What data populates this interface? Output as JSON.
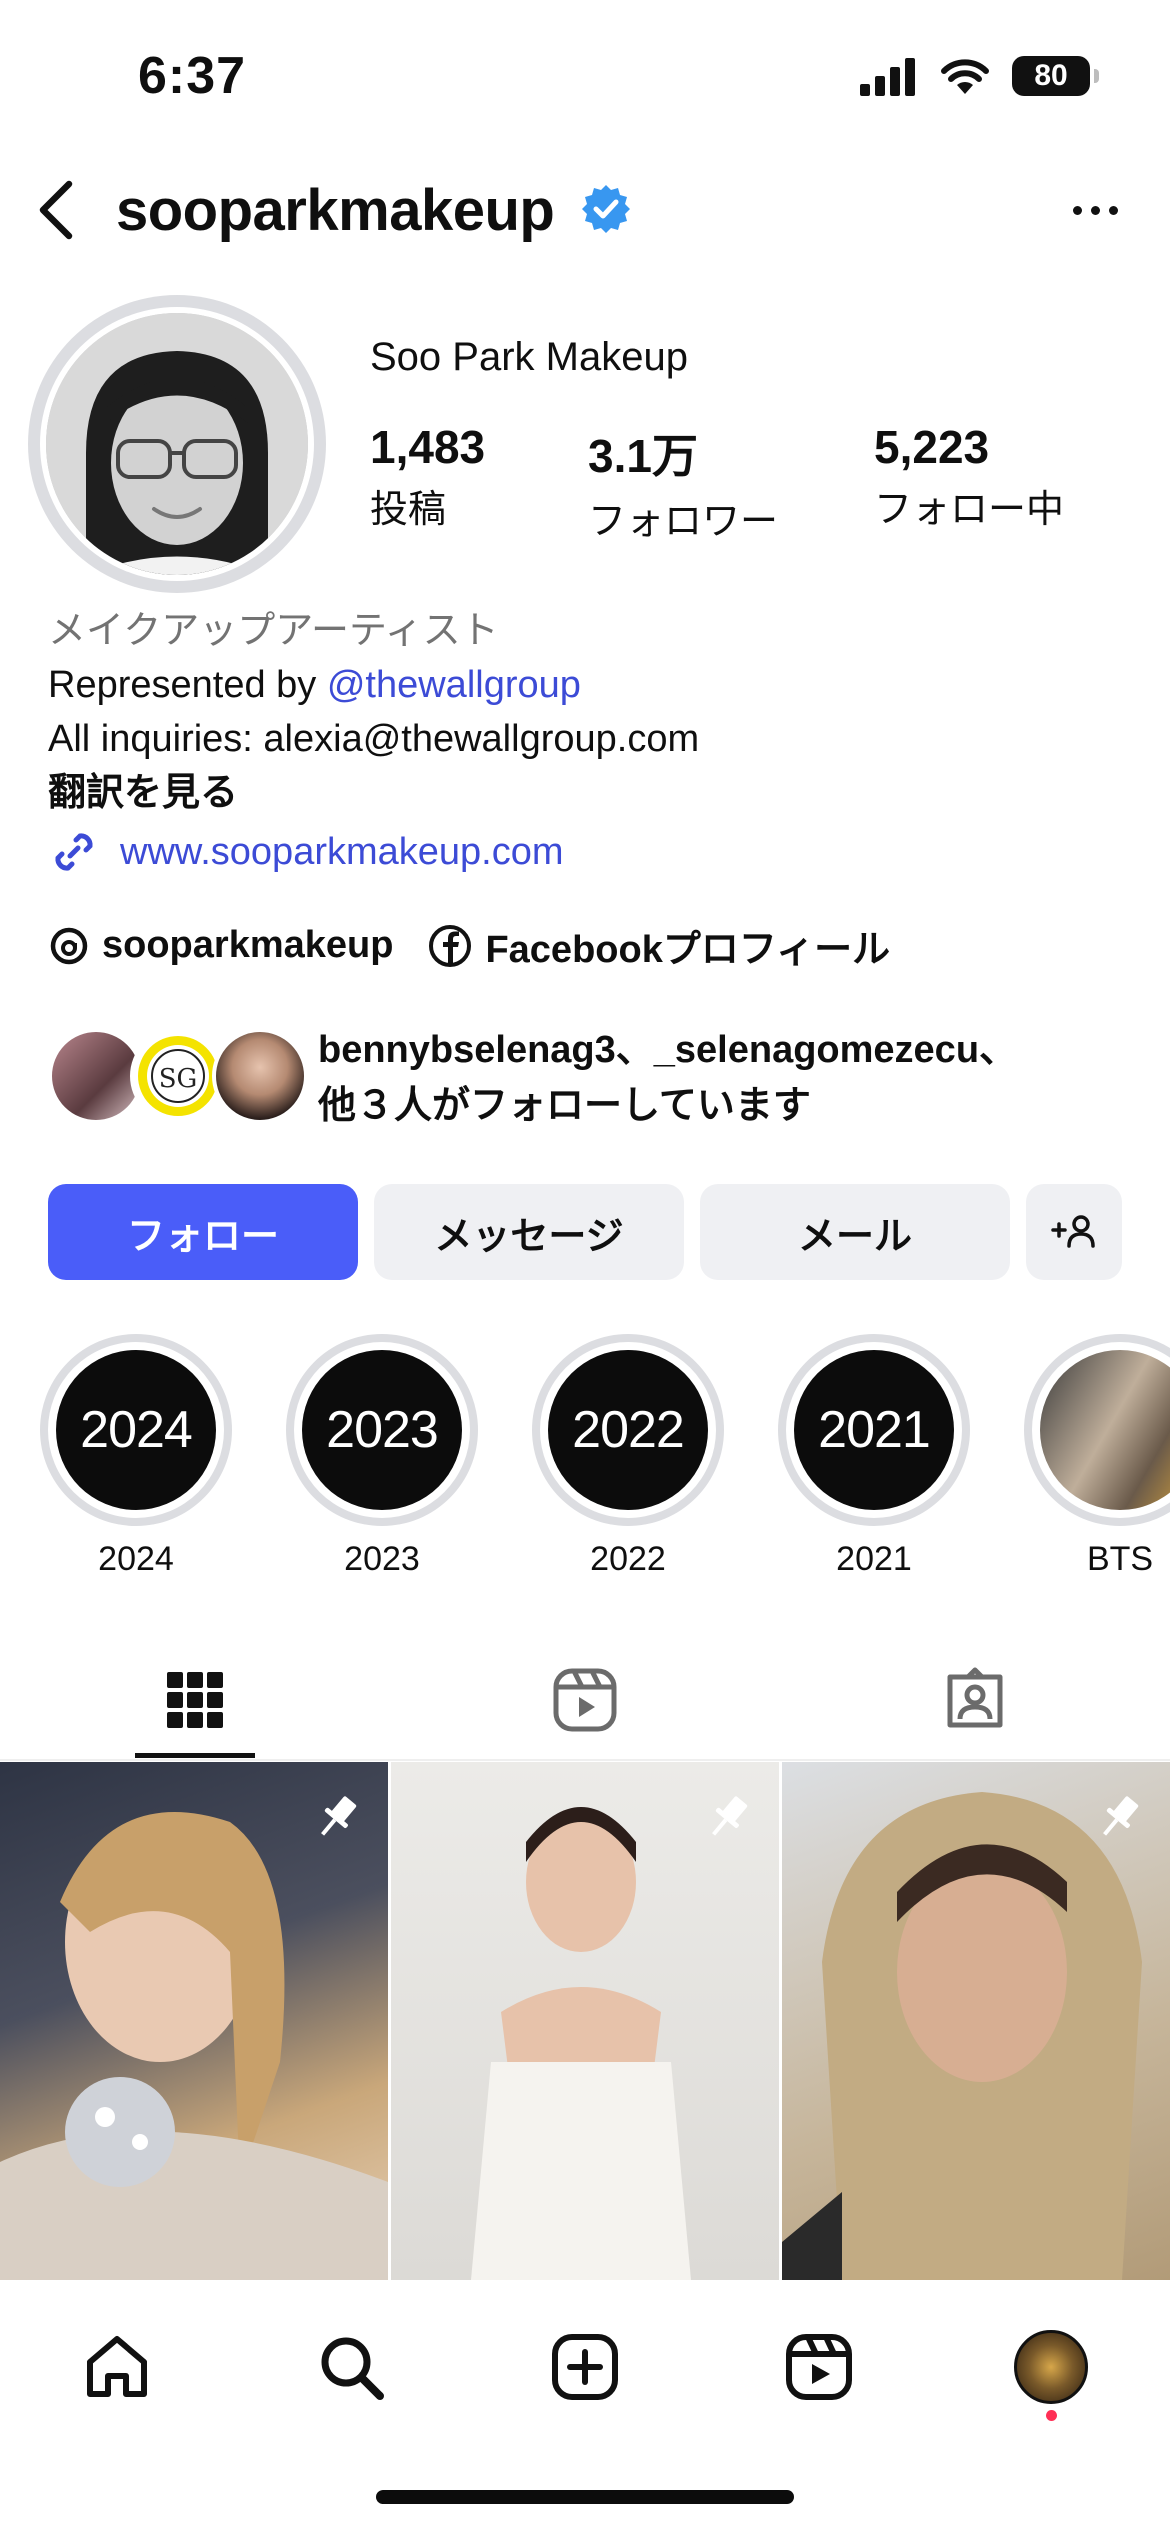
{
  "status_bar": {
    "time": "6:37",
    "battery": "80"
  },
  "header": {
    "username": "sooparkmakeup",
    "verified": true
  },
  "profile": {
    "display_name": "Soo Park Makeup",
    "stats": [
      {
        "value": "1,483",
        "label": "投稿"
      },
      {
        "value": "3.1万",
        "label": "フォロワー"
      },
      {
        "value": "5,223",
        "label": "フォロー中"
      }
    ],
    "bio": {
      "category": "メイクアップアーティスト",
      "represented_prefix": "Represented by ",
      "represented_mention": "@thewallgroup",
      "inquiries": "All inquiries: alexia@thewallgroup.com",
      "translate": "翻訳を見る",
      "link": "www.sooparkmakeup.com"
    },
    "social": {
      "threads_label": "sooparkmakeup",
      "facebook_label": "Facebookプロフィール"
    },
    "followed_by": {
      "line1": "bennybselenag3、_selenagomezecu、",
      "line2": "他３人がフォローしています"
    }
  },
  "actions": {
    "follow": "フォロー",
    "message": "メッセージ",
    "email": "メール"
  },
  "highlights": [
    {
      "cover": "2024",
      "label": "2024"
    },
    {
      "cover": "2023",
      "label": "2023"
    },
    {
      "cover": "2022",
      "label": "2022"
    },
    {
      "cover": "2021",
      "label": "2021"
    },
    {
      "cover": "",
      "label": "BTS"
    }
  ],
  "tabs": [
    {
      "icon": "grid-icon",
      "active": true
    },
    {
      "icon": "reels-icon",
      "active": false
    },
    {
      "icon": "tagged-icon",
      "active": false
    }
  ],
  "posts": [
    {
      "pinned": true
    },
    {
      "pinned": true
    },
    {
      "pinned": true
    }
  ],
  "bottom_nav": [
    "home-icon",
    "search-icon",
    "create-icon",
    "reels-icon",
    "profile-avatar"
  ],
  "colors": {
    "accent": "#4a5df9",
    "link": "#3c4bd6",
    "verified": "#3897f0",
    "muted": "#737373",
    "button_grey": "#eff0f3",
    "notification_dot": "#ff2f55"
  }
}
